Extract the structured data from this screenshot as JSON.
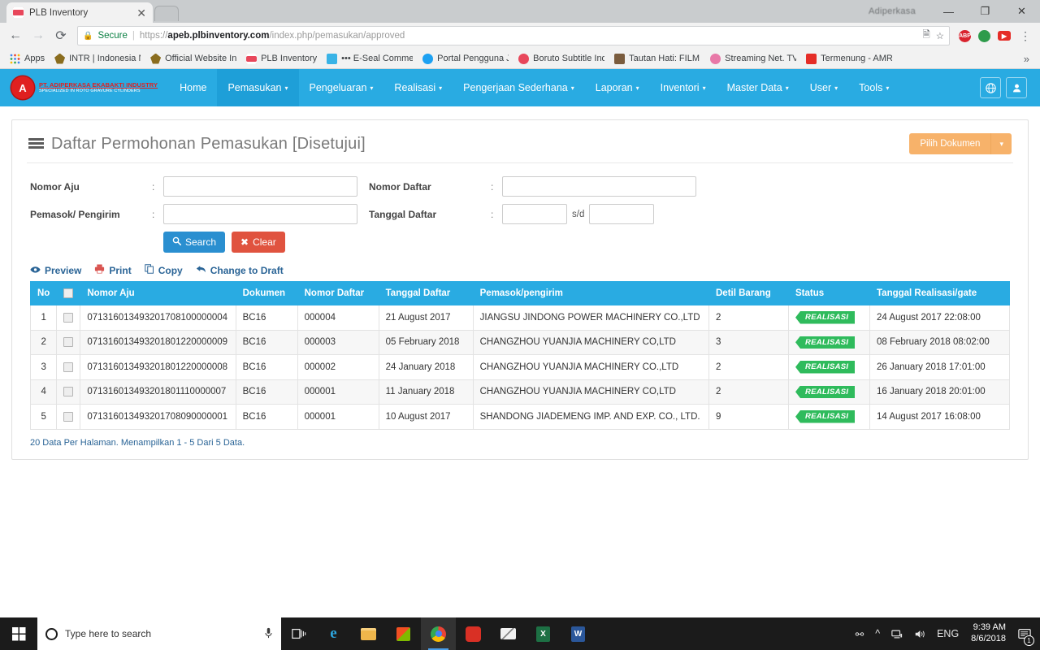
{
  "browser": {
    "tab_title": "PLB Inventory",
    "tab_close": "✕",
    "window_brand": "Adiperkasa",
    "minimize": "—",
    "maximize": "❐",
    "close": "✕",
    "back": "←",
    "forward": "→",
    "reload": "⟳",
    "secure_label": "Secure",
    "url_scheme": "https://",
    "url_domain": "apeb.plbinventory.com",
    "url_path": "/index.php/pemasukan/approved",
    "star": "☆",
    "kebab": "⋮",
    "bookmarks": [
      {
        "label": "Apps",
        "icon": "apps-grid-icon"
      },
      {
        "label": "INTR | Indonesia Nati",
        "icon": "garuda-icon"
      },
      {
        "label": "Official Website Indo",
        "icon": "garuda-icon"
      },
      {
        "label": "PLB Inventory",
        "icon": "plb-icon"
      },
      {
        "label": "••• E-Seal Commerci",
        "icon": "eseal-icon"
      },
      {
        "label": "Portal Pengguna Jasa",
        "icon": "twitter-icon"
      },
      {
        "label": "Boruto Subtitle Indon",
        "icon": "boruto-icon"
      },
      {
        "label": "Tautan Hati: FILM NA",
        "icon": "film-icon"
      },
      {
        "label": "Streaming Net. TV On",
        "icon": "s-icon"
      },
      {
        "label": "Termenung - AMRIZ",
        "icon": "youtube-icon"
      }
    ],
    "bookmarks_overflow": "»",
    "extensions": [
      {
        "name": "adblock-plus-icon",
        "glyph": "ABP"
      },
      {
        "name": "green-globe-icon",
        "glyph": ""
      },
      {
        "name": "youtube-downloader-icon",
        "glyph": "▶"
      }
    ]
  },
  "navbar": {
    "brand_name": "PT. ADIPERKASA EKABAKTI INDUSTRY",
    "brand_sub": "SPECIALIZED IN ROTO GRAVURE CYLINDERS",
    "brand_mark": "A",
    "items": [
      {
        "label": "Home",
        "caret": false,
        "active": false
      },
      {
        "label": "Pemasukan",
        "caret": true,
        "active": true
      },
      {
        "label": "Pengeluaran",
        "caret": true,
        "active": false
      },
      {
        "label": "Realisasi",
        "caret": true,
        "active": false
      },
      {
        "label": "Pengerjaan Sederhana",
        "caret": true,
        "active": false
      },
      {
        "label": "Laporan",
        "caret": true,
        "active": false
      },
      {
        "label": "Inventori",
        "caret": true,
        "active": false
      },
      {
        "label": "Master Data",
        "caret": true,
        "active": false
      },
      {
        "label": "User",
        "caret": true,
        "active": false
      },
      {
        "label": "Tools",
        "caret": true,
        "active": false
      }
    ],
    "caret_glyph": "▾",
    "globe_icon": "🌐",
    "user_icon": "👤",
    "bg_color": "#29ABE2"
  },
  "card": {
    "title": "Daftar Permohonan Pemasukan [Disetujui]",
    "pick_doc_label": "Pilih Dokumen",
    "pick_doc_caret": "▾",
    "pick_doc_color": "#f7b26a"
  },
  "filters": {
    "nomor_aju_label": "Nomor Aju",
    "nomor_aju_value": "",
    "pemasok_label": "Pemasok/ Pengirim",
    "pemasok_value": "",
    "nomor_daftar_label": "Nomor Daftar",
    "nomor_daftar_value": "",
    "tanggal_daftar_label": "Tanggal Daftar",
    "tanggal_from": "",
    "tanggal_to": "",
    "sd_label": "s/d",
    "colon": ":",
    "search_label": "Search",
    "search_icon": "🔍",
    "clear_label": "Clear",
    "clear_icon": "✖"
  },
  "table_actions": [
    {
      "label": "Preview",
      "icon": "eye-icon",
      "glyph": "👁"
    },
    {
      "label": "Print",
      "icon": "printer-icon",
      "glyph": "🖨"
    },
    {
      "label": "Copy",
      "icon": "copy-icon",
      "glyph": "⧉"
    },
    {
      "label": "Change to Draft",
      "icon": "undo-arrow-icon",
      "glyph": "↩"
    }
  ],
  "table": {
    "headers": [
      "No",
      "",
      "Nomor Aju",
      "Dokumen",
      "Nomor Daftar",
      "Tanggal Daftar",
      "Pemasok/pengirim",
      "Detil Barang",
      "Status",
      "Tanggal Realisasi/gate"
    ],
    "rows": [
      {
        "no": "1",
        "nomor_aju": "071316013493201708100000004",
        "dokumen": "BC16",
        "nomor_daftar": "000004",
        "tanggal_daftar": "21 August 2017",
        "pemasok": "JIANGSU JINDONG POWER MACHINERY CO.,LTD",
        "detil_barang": "2",
        "status": "REALISASI",
        "tanggal_realisasi": "24 August 2017 22:08:00"
      },
      {
        "no": "2",
        "nomor_aju": "071316013493201801220000009",
        "dokumen": "BC16",
        "nomor_daftar": "000003",
        "tanggal_daftar": "05 February 2018",
        "pemasok": "CHANGZHOU YUANJIA MACHINERY CO,LTD",
        "detil_barang": "3",
        "status": "REALISASI",
        "tanggal_realisasi": "08 February 2018 08:02:00"
      },
      {
        "no": "3",
        "nomor_aju": "071316013493201801220000008",
        "dokumen": "BC16",
        "nomor_daftar": "000002",
        "tanggal_daftar": "24 January 2018",
        "pemasok": "CHANGZHOU YUANJIA MACHINERY CO.,LTD",
        "detil_barang": "2",
        "status": "REALISASI",
        "tanggal_realisasi": "26 January 2018 17:01:00"
      },
      {
        "no": "4",
        "nomor_aju": "071316013493201801110000007",
        "dokumen": "BC16",
        "nomor_daftar": "000001",
        "tanggal_daftar": "11 January 2018",
        "pemasok": "CHANGZHOU YUANJIA MACHINERY CO,LTD",
        "detil_barang": "2",
        "status": "REALISASI",
        "tanggal_realisasi": "16 January 2018 20:01:00"
      },
      {
        "no": "5",
        "nomor_aju": "071316013493201708090000001",
        "dokumen": "BC16",
        "nomor_daftar": "000001",
        "tanggal_daftar": "10 August 2017",
        "pemasok": "SHANDONG JIADEMENG IMP. AND EXP. CO., LTD.",
        "detil_barang": "9",
        "status": "REALISASI",
        "tanggal_realisasi": "14 August 2017 16:08:00"
      }
    ],
    "status_color": "#2fbb5c",
    "header_color": "#29ABE2",
    "pagination_info": "20 Data Per Halaman. Menampilkan 1 - 5 Dari 5 Data."
  },
  "taskbar": {
    "search_placeholder": "Type here to search",
    "mic_icon": "🎤",
    "apps": [
      {
        "name": "task-view-icon",
        "glyph": "❐"
      },
      {
        "name": "edge-icon",
        "glyph": "e"
      },
      {
        "name": "file-explorer-icon",
        "glyph": ""
      },
      {
        "name": "microsoft-store-icon",
        "glyph": ""
      },
      {
        "name": "chrome-icon",
        "glyph": ""
      },
      {
        "name": "red-app-icon",
        "glyph": ""
      },
      {
        "name": "mail-icon",
        "glyph": ""
      },
      {
        "name": "excel-icon",
        "glyph": "X"
      },
      {
        "name": "word-icon",
        "glyph": "W"
      }
    ],
    "tray": [
      {
        "name": "share-icon",
        "glyph": "⚯"
      },
      {
        "name": "show-hidden-icons-icon",
        "glyph": "^"
      },
      {
        "name": "network-icon",
        "glyph": "🖧"
      },
      {
        "name": "volume-icon",
        "glyph": "🔊"
      },
      {
        "name": "language-indicator",
        "glyph": "ENG"
      }
    ],
    "clock_time": "9:39 AM",
    "clock_date": "8/6/2018",
    "notification_count": "1"
  }
}
